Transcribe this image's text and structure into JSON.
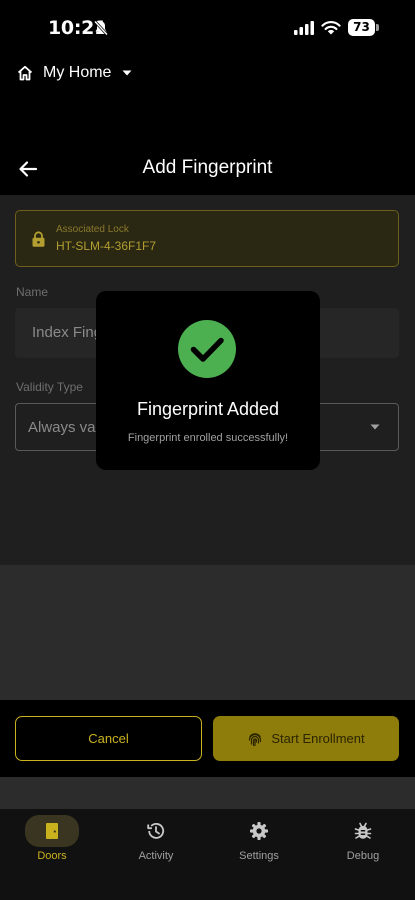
{
  "status_bar": {
    "time": "10:21",
    "battery": "73"
  },
  "home": {
    "name": "My Home"
  },
  "header": {
    "title": "Add Fingerprint"
  },
  "form": {
    "lock_caption": "Associated Lock",
    "lock_value": "HT-SLM-4-36F1F7",
    "name_label": "Name",
    "name_value": "Index Fing",
    "validity_label": "Validity Type",
    "validity_value": "Always vali"
  },
  "buttons": {
    "cancel": "Cancel",
    "enroll": "Start Enrollment"
  },
  "dialog": {
    "title": "Fingerprint Added",
    "message": "Fingerprint enrolled successfully!"
  },
  "nav": [
    {
      "label": "Doors",
      "icon": "door-icon",
      "active": true
    },
    {
      "label": "Activity",
      "icon": "history-icon",
      "active": false
    },
    {
      "label": "Settings",
      "icon": "gear-icon",
      "active": false
    },
    {
      "label": "Debug",
      "icon": "bug-icon",
      "active": false
    }
  ],
  "colors": {
    "accent": "#c9b21e",
    "success": "#4caf50",
    "background": "#000000"
  }
}
